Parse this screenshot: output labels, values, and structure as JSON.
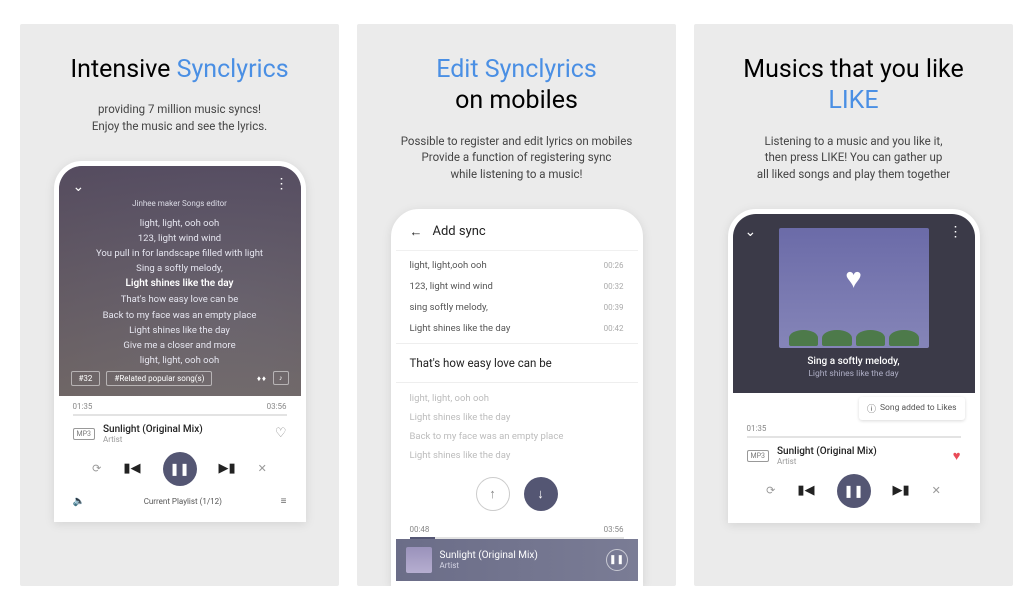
{
  "accent": "#4a8fe4",
  "panels": [
    {
      "title_a": "Intensive ",
      "title_b": "Synclyrics",
      "sub1": "providing 7 million music syncs!",
      "sub2": "Enjoy the music and see the lyrics.",
      "maker": "Jinhee maker Songs editor",
      "lyrics": [
        "light, light, ooh ooh",
        "123, light wind wind",
        "You pull in for landscape filled with light",
        "Sing a softly melody,",
        "Light shines like the day",
        "That's how easy love can be",
        "Back to my face was an empty place",
        "Light shines like the day",
        "Give me a closer and more",
        "light, light, ooh ooh"
      ],
      "current_idx": 4,
      "tag1": "#32",
      "tag2": "#Related popular song(s)",
      "time_l": "01:35",
      "time_r": "03:56",
      "mp3_badge": "MP3",
      "song": "Sunlight (Original Mix)",
      "artist": "Artist",
      "playlist": "Current Playlist (1/12)"
    },
    {
      "title_a": "Edit Synclyrics",
      "title_b": "on mobiles",
      "sub1": "Possible to register and edit lyrics on mobiles",
      "sub2": "Provide a function of registering sync",
      "sub3": "while listening to a music!",
      "header": "Add sync",
      "synced": [
        {
          "text": "light, light,ooh ooh",
          "t": "00:26"
        },
        {
          "text": "123, light wind wind",
          "t": "00:32"
        },
        {
          "text": "sing softly melody,",
          "t": "00:39"
        },
        {
          "text": "Light shines like the day",
          "t": "00:42"
        }
      ],
      "current": "That's how easy love can be",
      "pending": [
        "light, light, ooh ooh",
        "Light shines like the day",
        "Back to my face was an empty place",
        "Light shines like the day"
      ],
      "seek_l": "00:48",
      "seek_r": "03:56",
      "song": "Sunlight (Original Mix)",
      "artist": "Artist"
    },
    {
      "title_a": "Musics that you like",
      "title_b": "LIKE",
      "sub1": "Listening to a music and you like it,",
      "sub2": "then press LIKE! You can gather up",
      "sub3": "all liked songs and play them together",
      "lyric_cur": "Sing a softly melody,",
      "lyric_next": "Light shines like the day",
      "toast": "Song added to Likes",
      "time_l": "01:35",
      "mp3_badge": "MP3",
      "song": "Sunlight (Original Mix)",
      "artist": "Artist"
    }
  ]
}
